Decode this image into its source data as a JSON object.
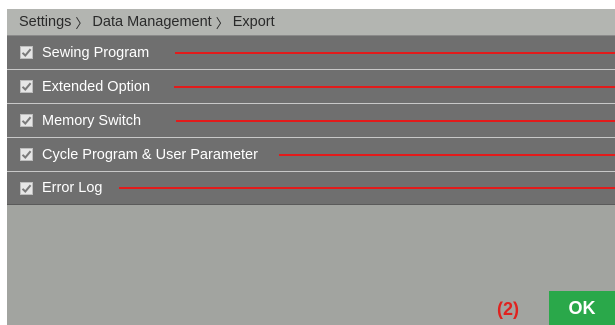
{
  "breadcrumb": {
    "items": [
      "Settings",
      "Data Management",
      "Export"
    ],
    "separator": "〉"
  },
  "export_items": [
    {
      "label": "Sewing Program",
      "checked": true
    },
    {
      "label": "Extended Option",
      "checked": true
    },
    {
      "label": "Memory Switch",
      "checked": true
    },
    {
      "label": "Cycle Program & User Parameter",
      "checked": true
    },
    {
      "label": "Error Log",
      "checked": true
    }
  ],
  "annotation": {
    "text": "(2)",
    "color": "#e0221f"
  },
  "ok_button": {
    "label": "OK",
    "color": "#2aa84a"
  },
  "colors": {
    "row_bg": "#6f6f6f",
    "screen_bg": "#a2a4a0",
    "callout_line": "#e21b1b"
  }
}
